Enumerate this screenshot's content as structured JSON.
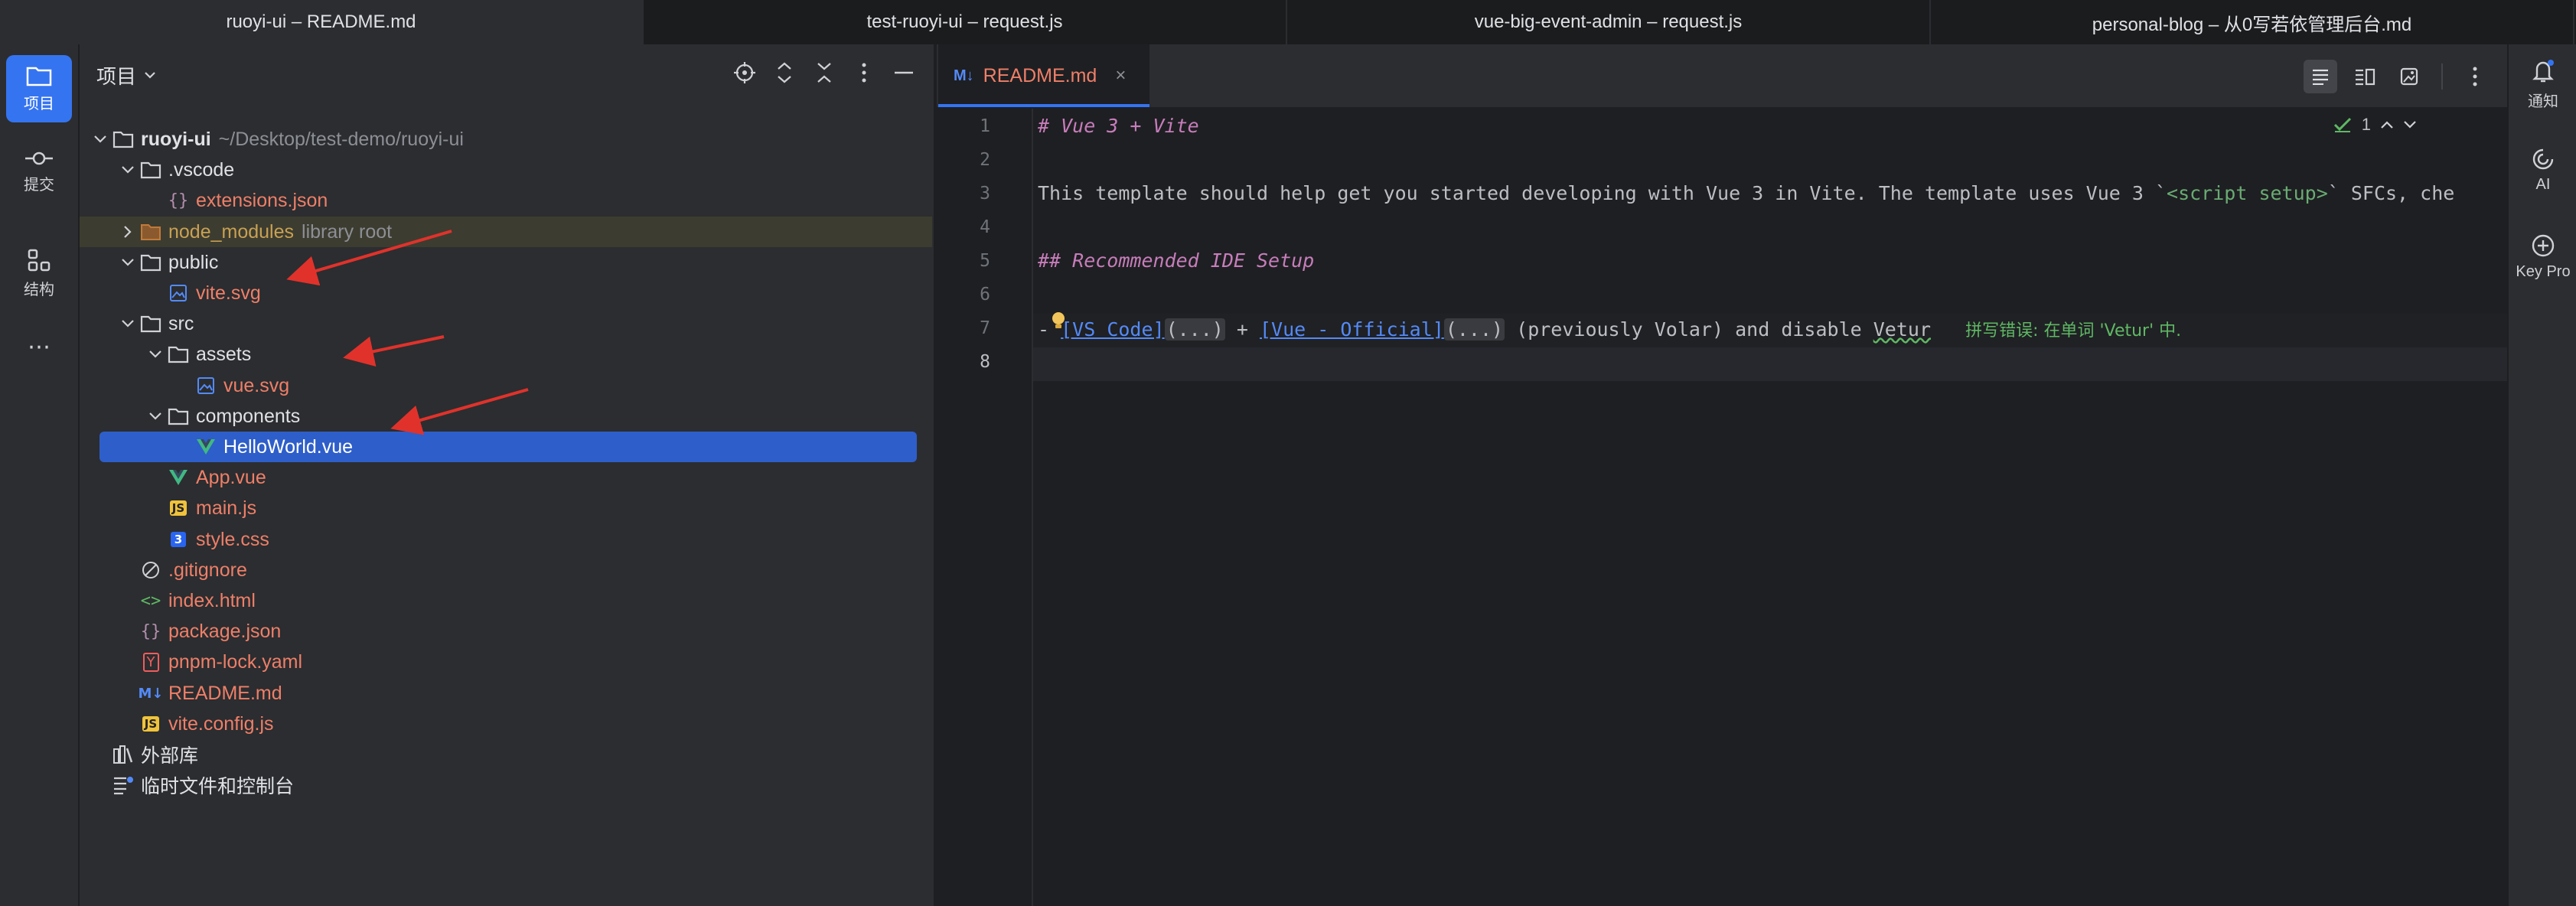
{
  "window_tabs": [
    {
      "label": "ruoyi-ui – README.md",
      "active": true
    },
    {
      "label": "test-ruoyi-ui – request.js",
      "active": false
    },
    {
      "label": "vue-big-event-admin – request.js",
      "active": false
    },
    {
      "label": "personal-blog – 从0写若依管理后台.md",
      "active": false
    }
  ],
  "left_toolbar": {
    "project": "项目",
    "commit": "提交",
    "structure": "结构",
    "more": "⋯"
  },
  "project_panel": {
    "title": "项目",
    "tree": [
      {
        "name": "ruoyi-ui",
        "hint": "~/Desktop/test-demo/ruoyi-ui",
        "icon": "folder",
        "depth": 0,
        "chevron": "down"
      },
      {
        "name": ".vscode",
        "hint": "",
        "icon": "folder",
        "depth": 1,
        "chevron": "down"
      },
      {
        "name": "extensions.json",
        "hint": "",
        "icon": "json",
        "depth": 2,
        "chevron": ""
      },
      {
        "name": "node_modules",
        "hint": "library root",
        "icon": "folder-excluded",
        "depth": 1,
        "chevron": "right"
      },
      {
        "name": "public",
        "hint": "",
        "icon": "folder",
        "depth": 1,
        "chevron": "down"
      },
      {
        "name": "vite.svg",
        "hint": "",
        "icon": "image",
        "depth": 2,
        "chevron": ""
      },
      {
        "name": "src",
        "hint": "",
        "icon": "folder",
        "depth": 1,
        "chevron": "down"
      },
      {
        "name": "assets",
        "hint": "",
        "icon": "folder",
        "depth": 2,
        "chevron": "down"
      },
      {
        "name": "vue.svg",
        "hint": "",
        "icon": "image",
        "depth": 3,
        "chevron": ""
      },
      {
        "name": "components",
        "hint": "",
        "icon": "folder",
        "depth": 2,
        "chevron": "down"
      },
      {
        "name": "HelloWorld.vue",
        "hint": "",
        "icon": "vue",
        "depth": 3,
        "chevron": ""
      },
      {
        "name": "App.vue",
        "hint": "",
        "icon": "vue",
        "depth": 2,
        "chevron": ""
      },
      {
        "name": "main.js",
        "hint": "",
        "icon": "js",
        "depth": 2,
        "chevron": ""
      },
      {
        "name": "style.css",
        "hint": "",
        "icon": "css",
        "depth": 2,
        "chevron": ""
      },
      {
        "name": ".gitignore",
        "hint": "",
        "icon": "ignore",
        "depth": 1,
        "chevron": ""
      },
      {
        "name": "index.html",
        "hint": "",
        "icon": "html",
        "depth": 1,
        "chevron": ""
      },
      {
        "name": "package.json",
        "hint": "",
        "icon": "json",
        "depth": 1,
        "chevron": ""
      },
      {
        "name": "pnpm-lock.yaml",
        "hint": "",
        "icon": "yaml",
        "depth": 1,
        "chevron": ""
      },
      {
        "name": "README.md",
        "hint": "",
        "icon": "md",
        "depth": 1,
        "chevron": ""
      },
      {
        "name": "vite.config.js",
        "hint": "",
        "icon": "js",
        "depth": 1,
        "chevron": ""
      },
      {
        "name": "外部库",
        "hint": "",
        "icon": "library",
        "depth": 0,
        "chevron": ""
      },
      {
        "name": "临时文件和控制台",
        "hint": "",
        "icon": "scratch",
        "depth": 0,
        "chevron": ""
      }
    ]
  },
  "editor": {
    "tab_label": "README.md",
    "tab_badge": "M↓",
    "inspection_count": "1",
    "line_numbers": [
      "1",
      "2",
      "3",
      "4",
      "5",
      "6",
      "7",
      "8"
    ],
    "line1": "# Vue 3 + Vite",
    "line3_a": "This template should help get you started developing with Vue 3 in Vite. The template uses Vue 3 `",
    "line3_tag": "<script setup>",
    "line3_b": "` SFCs, che",
    "line5": "## Recommended IDE Setup",
    "line7_dash": "- ",
    "line7_link1": "[VS Code]",
    "line7_fold1": "(...)",
    "line7_plus": " + ",
    "line7_link2": "[Vue - Official]",
    "line7_fold2": "(...)",
    "line7_rest": " (previously Volar) and disable ",
    "line7_typo": "Vetur",
    "line7_hint": "拼写错误: 在单词 'Vetur' 中."
  },
  "right_toolbar": {
    "notifications": "通知",
    "ai": "AI",
    "key_promoter": "Key Pro"
  }
}
